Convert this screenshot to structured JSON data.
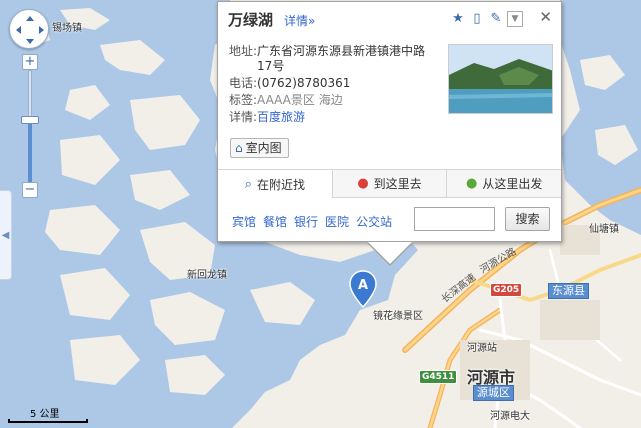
{
  "map": {
    "places": {
      "xichangzhen": "锡场镇",
      "xinhuilongzhen": "新回龙镇",
      "jinghuayuan": "镜花缘景区",
      "xiantangzhen": "仙塘镇",
      "dongyuanxian": "东源县",
      "heyuanzhan": "河源站",
      "heyuanshi": "河源市",
      "yuanchengqu": "源城区",
      "heyuandianda": "河源电大"
    },
    "roads": {
      "changshen": "长深高速",
      "heyuan_road": "河源公路",
      "g205": "G205",
      "g4511": "G4511"
    },
    "scale_label": "5 公里",
    "marker_label": "A"
  },
  "popup": {
    "title": "万绿湖",
    "detail_link": "详情»",
    "address_key": "地址:",
    "address_value": "广东省河源东源县新港镇港中路17号",
    "phone_key": "电话:",
    "phone_value": "(0762)8780361",
    "tag_key": "标签:",
    "tag_value": "AAAA景区 海边",
    "detail_key": "详情:",
    "detail_value": "百度旅游",
    "indoor_button": "室内图",
    "tabs": [
      "在附近找",
      "到这里去",
      "从这里出发"
    ],
    "nearby": [
      "宾馆",
      "餐馆",
      "银行",
      "医院",
      "公交站"
    ],
    "search_placeholder": "",
    "search_button": "搜索",
    "close": "✕"
  },
  "colors": {
    "water": "#adc8e6",
    "land": "#f2efe9",
    "link": "#3366cc",
    "marker": "#3b7ad0"
  }
}
